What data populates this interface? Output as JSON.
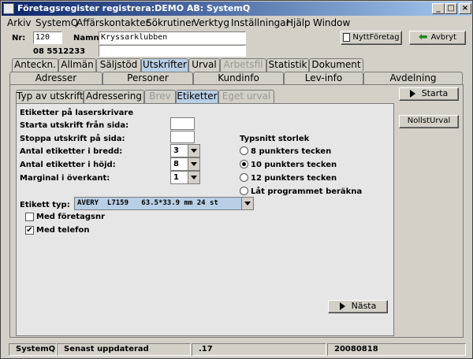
{
  "window": {
    "title": "Företagsregister registrera:DEMO AB: SystemQ",
    "controls": {
      "minimize": "_",
      "maximize": "□",
      "close": "×"
    }
  },
  "menu": [
    "Arkiv",
    "SystemQ",
    "Affärskontakter",
    "Sökrutiner",
    "Verktyg",
    "Inställningar",
    "Hjälp",
    "Window"
  ],
  "header": {
    "nr_label": "Nr:",
    "nr_value": "120",
    "namn_label": "Namn:",
    "namn_value": "Kryssarklubben",
    "phone": "08 5512233",
    "new_company_button": "NyttFöretag",
    "cancel_button": "Avbryt"
  },
  "tabs_row1": [
    "Anteckn.",
    "Allmän",
    "Säljstöd",
    "Utskrifter",
    "Urval",
    "Arbetsfil",
    "Statistik",
    "Dokument"
  ],
  "tabs_row2": [
    "Adresser",
    "Personer",
    "Kundinfo",
    "Lev-info",
    "Avdelning"
  ],
  "subtabs": [
    "Typ av utskrift",
    "Adressering",
    "Brev",
    "Etiketter",
    "Eget urval"
  ],
  "active_tab": "Utskrifter",
  "active_subtab": "Etiketter",
  "side_buttons": {
    "start": "Starta",
    "reset": "NollstUrval"
  },
  "labels_form": {
    "section_title": "Etiketter på laserskrivare",
    "start_page_label": "Starta utskrift från sida:",
    "start_page_value": "",
    "stop_page_label": "Stoppa utskrift på sida:",
    "stop_page_value": "",
    "across_label": "Antal etiketter i bredd:",
    "across_value": "3",
    "down_label": "Antal etiketter i höjd:",
    "down_value": "8",
    "margin_label": "Marginal i överkant:",
    "margin_value": "1",
    "type_label": "Etikett typ:",
    "type_value": "AVERY  L7159   63.5*33.9 mm 24 st",
    "with_org_no": "Med företagsnr",
    "with_org_no_checked": false,
    "with_phone": "Med telefon",
    "with_phone_checked": true,
    "font_size_title": "Typsnitt storlek",
    "font_options": [
      "8 punkters  tecken",
      "10 punkters tecken",
      "12 punkters tecken",
      "Låt programmet beräkna"
    ],
    "font_selected_index": 1,
    "next_button": "Nästa"
  },
  "statusbar": [
    "SystemQ",
    "Senast uppdaterad",
    ".17",
    "20080818"
  ]
}
